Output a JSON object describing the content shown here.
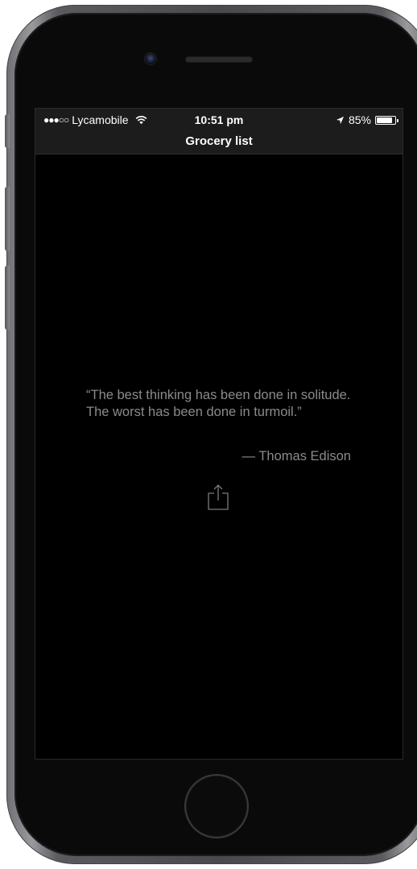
{
  "status_bar": {
    "signal": "●●●○○",
    "carrier": "Lycamobile",
    "time": "10:51 pm",
    "battery_percent": "85%",
    "battery_level": 0.85
  },
  "nav": {
    "title": "Grocery list"
  },
  "quote": {
    "text": "“The best thinking has been done in solitude. The worst has been done in turmoil.”",
    "author": "— Thomas Edison"
  },
  "icons": {
    "wifi": "wifi-icon",
    "location": "location-arrow-icon",
    "battery": "battery-icon",
    "share": "share-icon"
  },
  "colors": {
    "screen_background": "#000000",
    "navbar_background": "#1c1c1c",
    "quote_text": "#8a8a8a"
  }
}
